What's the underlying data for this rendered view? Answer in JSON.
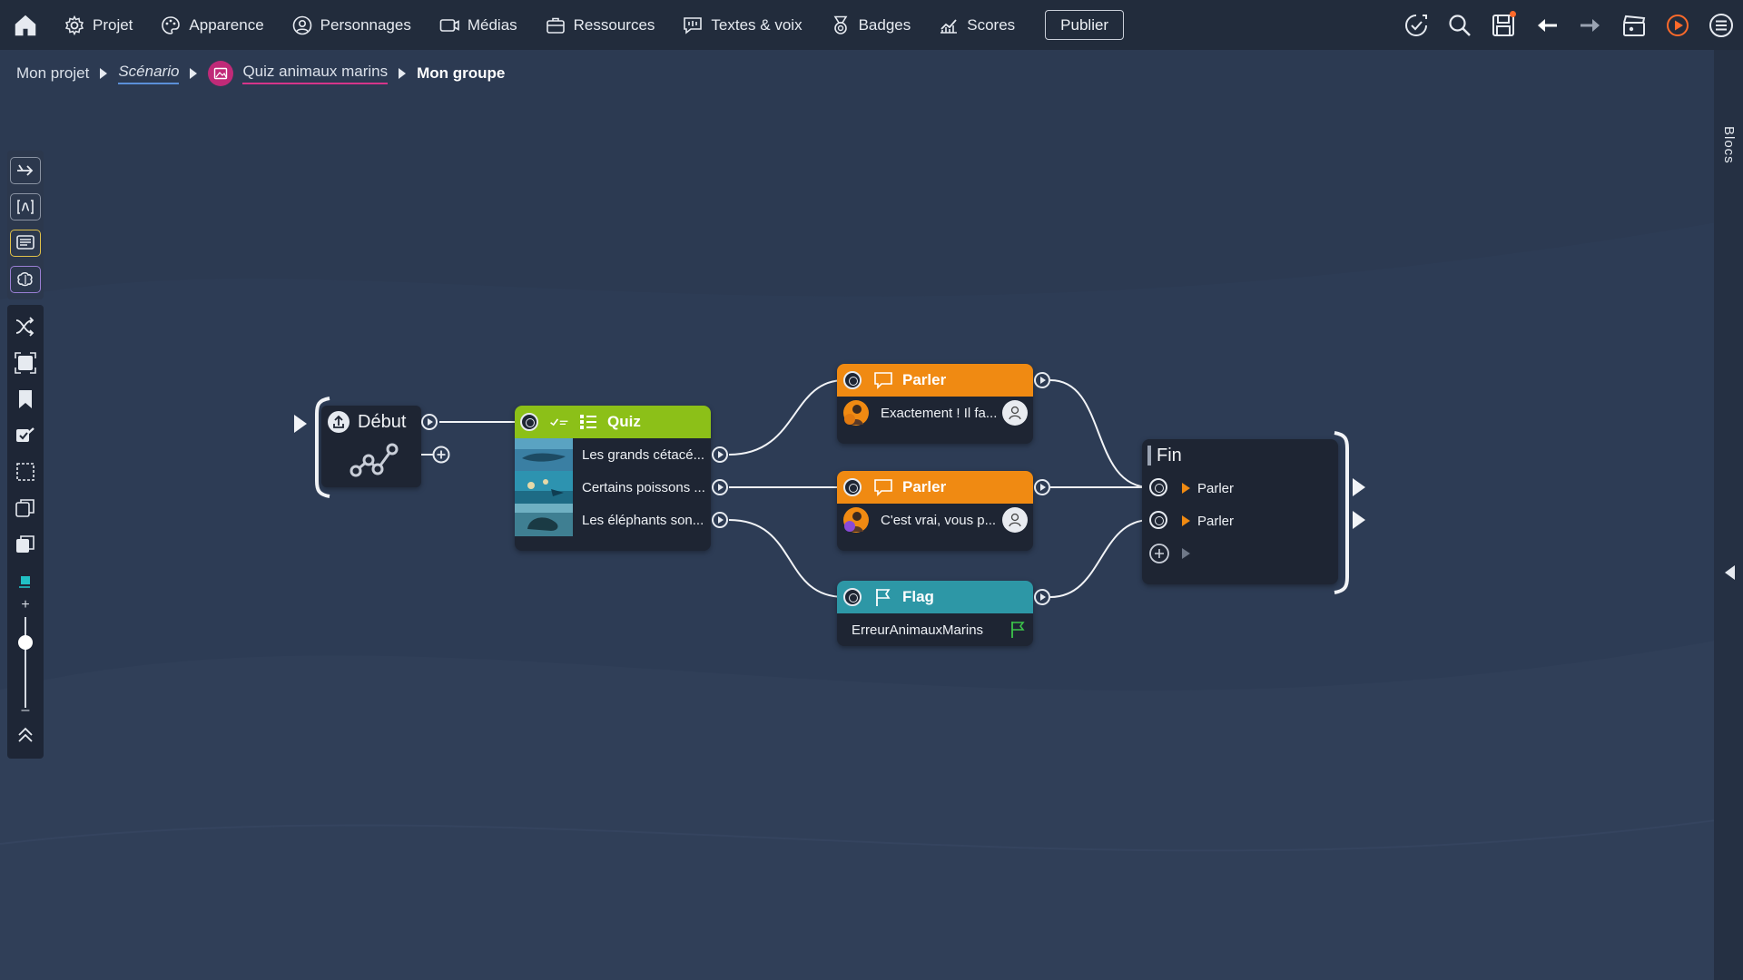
{
  "topbar": {
    "menu": [
      {
        "label": "Projet",
        "icon": "gear-icon"
      },
      {
        "label": "Apparence",
        "icon": "palette-icon"
      },
      {
        "label": "Personnages",
        "icon": "person-icon"
      },
      {
        "label": "Médias",
        "icon": "media-icon"
      },
      {
        "label": "Ressources",
        "icon": "briefcase-icon"
      },
      {
        "label": "Textes & voix",
        "icon": "speech-icon"
      },
      {
        "label": "Badges",
        "icon": "badge-icon"
      },
      {
        "label": "Scores",
        "icon": "chart-icon"
      }
    ],
    "publish_label": "Publier",
    "right_tools": [
      "validate-icon",
      "search-icon",
      "save-icon",
      "undo-icon",
      "redo-icon",
      "clapper-icon",
      "play-icon",
      "menu-icon"
    ]
  },
  "breadcrumb": {
    "project": "Mon projet",
    "scenario": "Scénario",
    "quiz": "Quiz animaux marins",
    "group": "Mon groupe"
  },
  "right_panel": {
    "label": "Blocs"
  },
  "colors": {
    "quiz": "#8cc018",
    "parler": "#f08a12",
    "flag": "#2d97a6",
    "canvas": "#2c3a52",
    "topbar": "#222c3c"
  },
  "nodes": {
    "debut": {
      "title": "Début"
    },
    "quiz": {
      "title": "Quiz",
      "answers": [
        "Les grands cétacé...",
        "Certains poissons ...",
        "Les éléphants son..."
      ]
    },
    "parler1": {
      "title": "Parler",
      "text": "Exactement ! Il fa..."
    },
    "parler2": {
      "title": "Parler",
      "text": "C'est vrai, vous p..."
    },
    "flag": {
      "title": "Flag",
      "text": "ErreurAnimauxMarins"
    },
    "fin": {
      "title": "Fin",
      "items": [
        "Parler",
        "Parler"
      ]
    }
  }
}
